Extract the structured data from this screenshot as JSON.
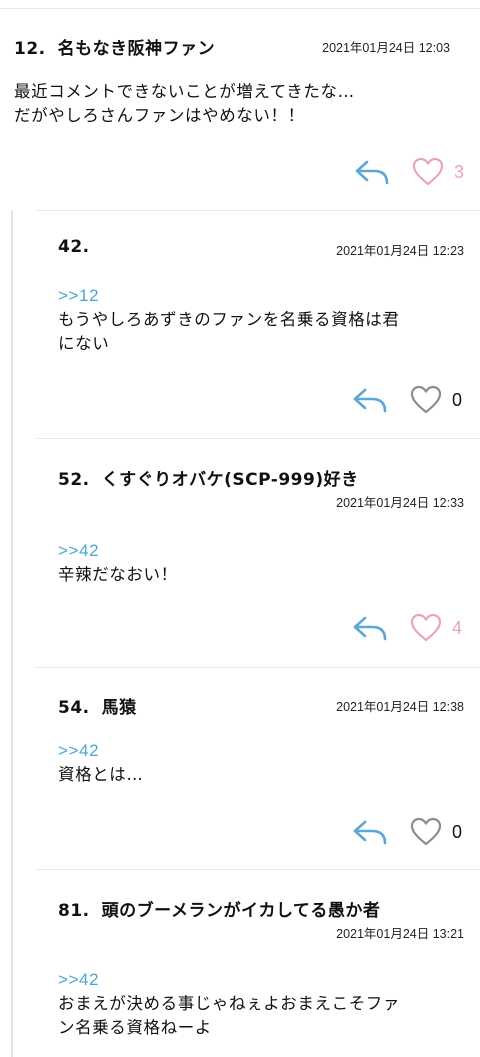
{
  "colors": {
    "reply_icon": "#5ea6d3",
    "heart_liked": "#e9a4bd",
    "heart_unliked": "#8c8c8c",
    "anchor": "#4aa6d3"
  },
  "comments": [
    {
      "number": "12.",
      "name": "名もなき阪神ファン",
      "date": "2021年01月24日 12:03",
      "anchor": "",
      "lines": [
        "最近コメントできないことが増えてきたな…",
        "だがやしろさんファンはやめない！！"
      ],
      "likes": "3",
      "liked": true
    },
    {
      "number": "42.",
      "name": "",
      "date": "2021年01月24日 12:23",
      "anchor": ">>12",
      "lines": [
        "もうやしろあずきのファンを名乗る資格は君",
        "にない"
      ],
      "likes": "0",
      "liked": false
    },
    {
      "number": "52.",
      "name": "くすぐりオバケ(SCP-999)好き",
      "date": "2021年01月24日 12:33",
      "anchor": ">>42",
      "lines": [
        "辛辣だなおい！"
      ],
      "likes": "4",
      "liked": true
    },
    {
      "number": "54.",
      "name": "馬猿",
      "date": "2021年01月24日 12:38",
      "anchor": ">>42",
      "lines": [
        "資格とは…"
      ],
      "likes": "0",
      "liked": false
    },
    {
      "number": "81.",
      "name": "頭のブーメランがイカしてる愚か者",
      "date": "2021年01月24日 13:21",
      "anchor": ">>42",
      "lines": [
        "おまえが決める事じゃねぇよおまえこそファ",
        "ン名乗る資格ねーよ"
      ]
    }
  ]
}
